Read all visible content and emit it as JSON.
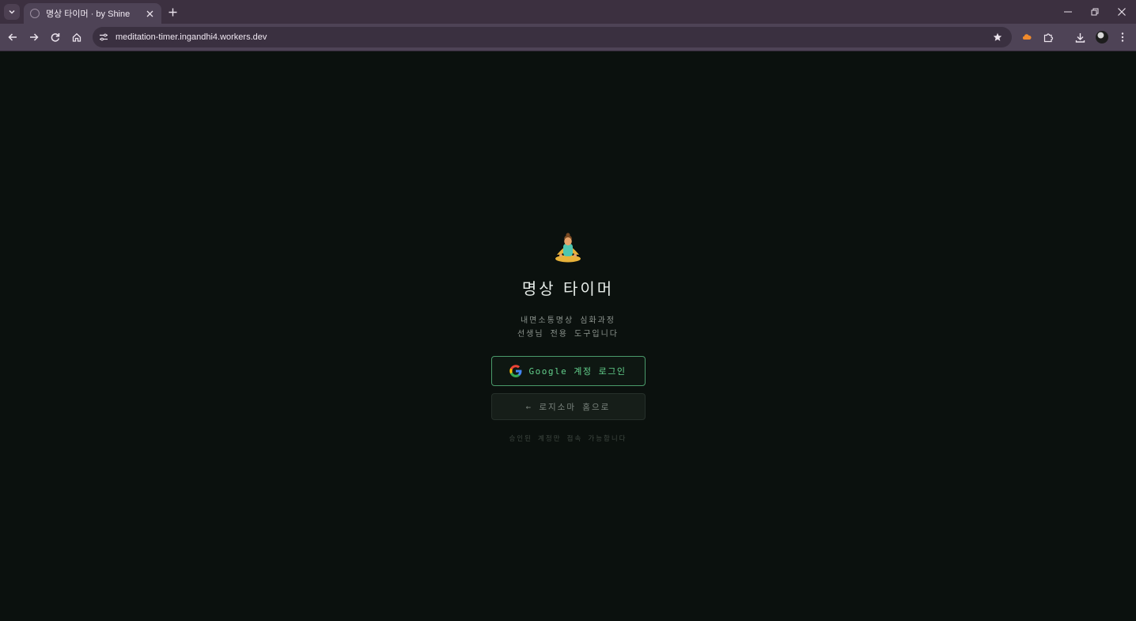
{
  "browser": {
    "tab": {
      "title": "명상 타이머 · by Shine"
    },
    "omnibox": {
      "url": "meditation-timer.ingandhi4.workers.dev"
    }
  },
  "page": {
    "title": "명상 타이머",
    "description_line1": "내면소통명상 심화과정",
    "description_line2": "선생님 전용 도구입니다",
    "google_button_label": "Google 계정 로그인",
    "home_button_label": "← 로지소마 홈으로",
    "note": "승인된 계정만 접속 가능합니다",
    "logo_icon": "meditation-person-emoji"
  },
  "colors": {
    "accent": "#63d08c",
    "background": "#0b110e"
  }
}
